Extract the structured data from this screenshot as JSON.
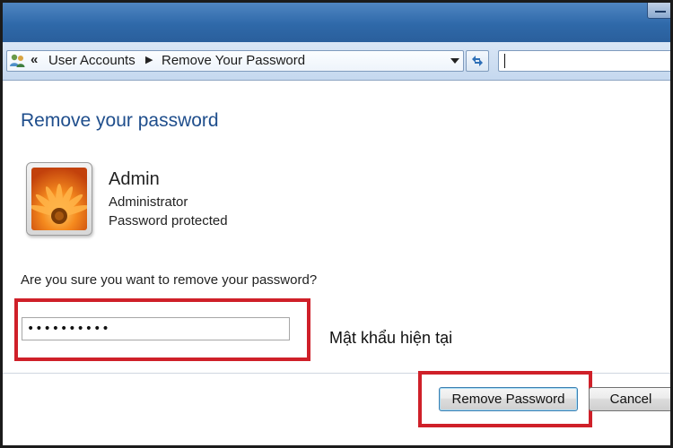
{
  "addressbar": {
    "breadcrumb": [
      "User Accounts",
      "Remove Your Password"
    ],
    "search_placeholder": ""
  },
  "page": {
    "heading": "Remove your password"
  },
  "user": {
    "name": "Admin",
    "role": "Administrator",
    "status": "Password protected",
    "avatar_icon": "flower-avatar-icon"
  },
  "form": {
    "question": "Are you sure you want to remove your password?",
    "password_value": "••••••••••",
    "annotation": "Mật khẩu hiện tại"
  },
  "buttons": {
    "remove_label": "Remove Password",
    "cancel_label": "Cancel"
  },
  "colors": {
    "heading": "#1f4e8c",
    "highlight": "#cf2029"
  }
}
